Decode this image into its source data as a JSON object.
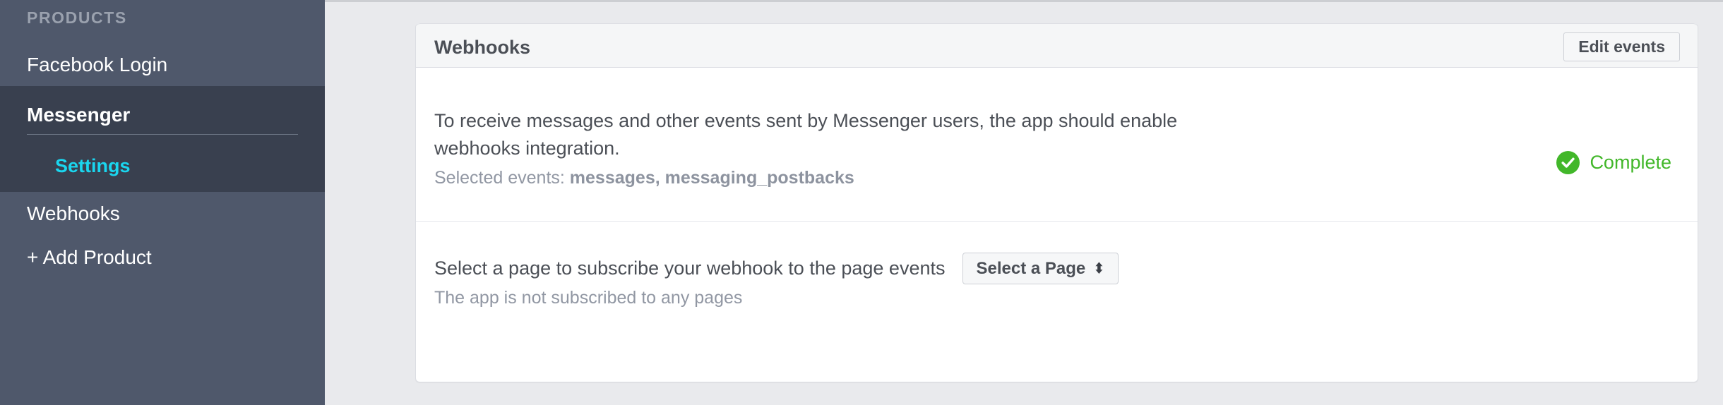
{
  "sidebar": {
    "section_title": "PRODUCTS",
    "items": [
      {
        "label": "Facebook Login"
      },
      {
        "label": "Webhooks"
      },
      {
        "label": "+ Add Product"
      }
    ],
    "active_product": {
      "label": "Messenger",
      "subitems": [
        {
          "label": "Settings"
        }
      ]
    }
  },
  "card": {
    "title": "Webhooks",
    "edit_events_label": "Edit events",
    "description": "To receive messages and other events sent by Messenger users, the app should enable webhooks integration.",
    "selected_events_prefix": "Selected events: ",
    "selected_events_value": "messages, messaging_postbacks",
    "status": {
      "label": "Complete",
      "icon": "check-circle-icon",
      "color": "#42b72a"
    },
    "subscribe": {
      "label": "Select a page to subscribe your webhook to the page events",
      "select_button_label": "Select a Page",
      "select_caret_glyph": "⬍",
      "note": "The app is not subscribed to any pages"
    }
  },
  "colors": {
    "page_background": "#e9eaed",
    "sidebar_background": "#4f586b",
    "sidebar_active_background": "#39404f",
    "sidebar_accent": "#1ad6ef",
    "card_header_background": "#f5f6f7",
    "text_primary": "#4b4f56",
    "text_muted": "#9197a3",
    "success": "#42b72a"
  }
}
